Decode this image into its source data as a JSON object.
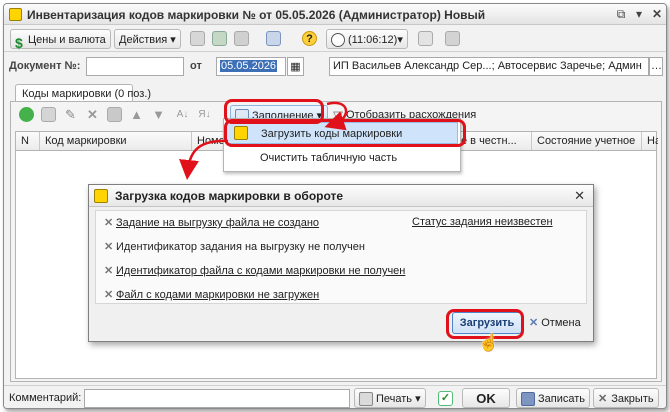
{
  "window": {
    "title": "Инвентаризация кодов маркировки №  от 05.05.2026 (Администратор) Новый",
    "controls": {
      "copy": "⧉",
      "menu": "▾",
      "close": "✕"
    }
  },
  "toolbar": {
    "prices_label": "Цены и валюта",
    "actions_label": "Действия",
    "help_label": "?",
    "time_label": "(11:06:12)",
    "dropdown_arrow": "▾"
  },
  "doc": {
    "number_label": "Документ №:",
    "number_value": "",
    "date_label": "от",
    "date_value": "05.05.2026",
    "org_value": "ИП Васильев Александр Сер...; Автосервис Заречье; Админ",
    "calendar_glyph": "▦",
    "org_button": "…"
  },
  "tab": {
    "label": "Коды маркировки (0 поз.)"
  },
  "inner_toolbar": {
    "fill_label": "Заполнение",
    "diff_label": "Отобразить расхождения"
  },
  "table": {
    "columns": [
      "N",
      "Код маркировки",
      "Номен",
      "е в честн...",
      "Состояние учетное",
      "На"
    ]
  },
  "fill_menu": {
    "items": [
      "Загрузить коды маркировки",
      "Очистить табличную часть"
    ]
  },
  "dialog": {
    "title": "Загрузка кодов маркировки в обороте",
    "close_glyph": "✕",
    "rows": [
      "Задание на выгрузку файла не создано",
      "Идентификатор задания на выгрузку не получен",
      "Идентификатор файла с кодами маркировки не получен",
      "Файл с кодами маркировки не загружен"
    ],
    "status_link": "Статус задания неизвестен",
    "load_button": "Загрузить",
    "cancel_button": "Отмена"
  },
  "footer": {
    "comment_label": "Комментарий:",
    "comment_value": "",
    "print_label": "Печать",
    "ok_label": "OK",
    "save_label": "Записать",
    "close_label": "Закрыть"
  },
  "colors": {
    "highlight": "#e0111a",
    "accent": "#4f82c6"
  }
}
